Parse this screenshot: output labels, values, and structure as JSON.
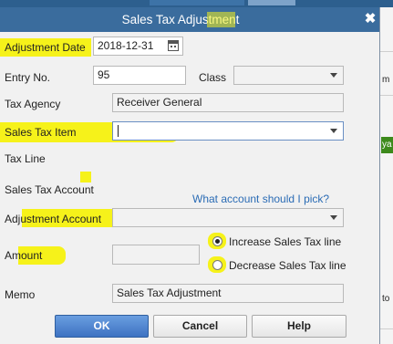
{
  "window": {
    "title": "Sales Tax Adjustment",
    "close_icon": "close-icon"
  },
  "background": {
    "right_snippets": [
      "m",
      "ya",
      "to"
    ]
  },
  "form": {
    "adjustment_date": {
      "label": "Adjustment Date",
      "value": "2018-12-31",
      "icon": "calendar-icon"
    },
    "entry_no": {
      "label": "Entry No.",
      "value": "95"
    },
    "class": {
      "label": "Class",
      "value": ""
    },
    "tax_agency": {
      "label": "Tax Agency",
      "value": "Receiver General"
    },
    "sales_tax_item": {
      "label": "Sales Tax Item",
      "value": ""
    },
    "tax_line": {
      "label": "Tax Line"
    },
    "sales_tax_account": {
      "label": "Sales Tax Account"
    },
    "help_link": "What account should I pick?",
    "adjustment_account": {
      "label": "Adjustment Account",
      "value": ""
    },
    "amount": {
      "label": "Amount",
      "value": ""
    },
    "options": {
      "increase": {
        "label": "Increase Sales Tax line",
        "checked": true
      },
      "decrease": {
        "label": "Decrease Sales Tax line",
        "checked": false
      }
    },
    "memo": {
      "label": "Memo",
      "value": "Sales Tax Adjustment"
    }
  },
  "buttons": {
    "ok": "OK",
    "cancel": "Cancel",
    "help": "Help"
  },
  "colors": {
    "titlebar": "#3a6c9d",
    "highlight": "#f6f21a",
    "primary_button": "#4a82cf",
    "link": "#2b6cb5"
  }
}
